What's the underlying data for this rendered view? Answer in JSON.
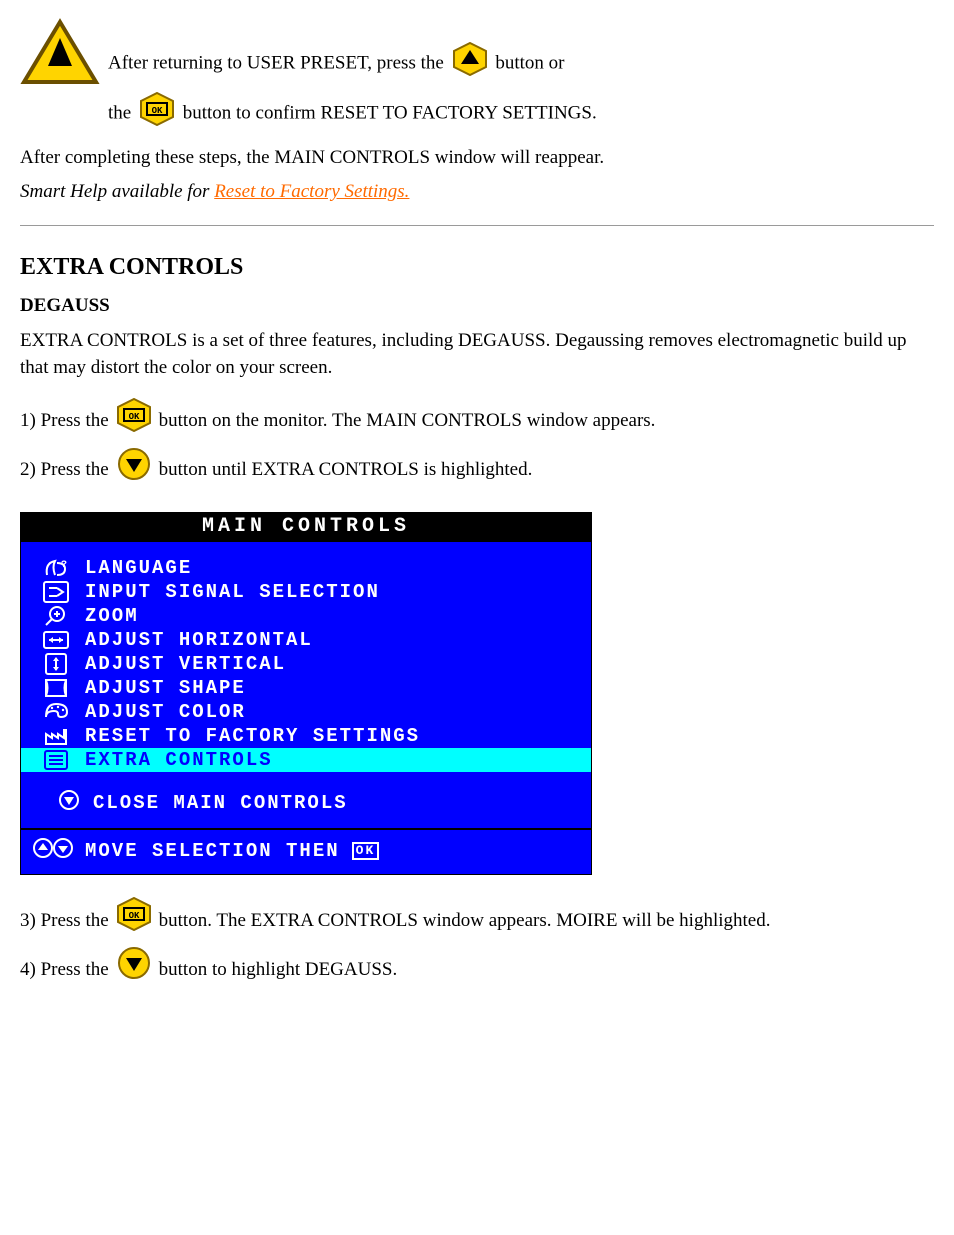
{
  "warning": {
    "line1_before": "After returning to USER PRESET, press the ",
    "line1_after": " button or",
    "line2_before": "the ",
    "line2_after": " button to confirm RESET TO FACTORY SETTINGS."
  },
  "after_text": "After completing these steps, the MAIN CONTROLS window will reappear.",
  "smart_help_note_before": "Smart Help available for ",
  "smart_help_link": "Reset to Factory Settings.",
  "section": {
    "title": "EXTRA CONTROLS",
    "subtitle": "DEGAUSS",
    "intro": "EXTRA CONTROLS is a set of three features, including DEGAUSS. Degaussing removes electromagnetic build up that may distort the color on your screen.",
    "step1_before": "1) Press the ",
    "step1_after": " button on the monitor. The MAIN CONTROLS window appears.",
    "step2_before": "2) Press the ",
    "step2_after": " button until EXTRA CONTROLS is highlighted."
  },
  "osd": {
    "title": "MAIN CONTROLS",
    "items": [
      "LANGUAGE",
      "INPUT SIGNAL SELECTION",
      "ZOOM",
      "ADJUST HORIZONTAL",
      "ADJUST VERTICAL",
      "ADJUST SHAPE",
      "ADJUST COLOR",
      "RESET TO FACTORY SETTINGS",
      "EXTRA CONTROLS"
    ],
    "close_label": "CLOSE MAIN CONTROLS",
    "hint_text": "MOVE SELECTION THEN",
    "ok_glyph": "OK"
  },
  "after_osd": {
    "step3_before": "3) Press the ",
    "step3_after": " button. The EXTRA CONTROLS window appears. MOIRE will be highlighted.",
    "step4_before": "4) Press the ",
    "step4_after": " button to highlight DEGAUSS."
  }
}
